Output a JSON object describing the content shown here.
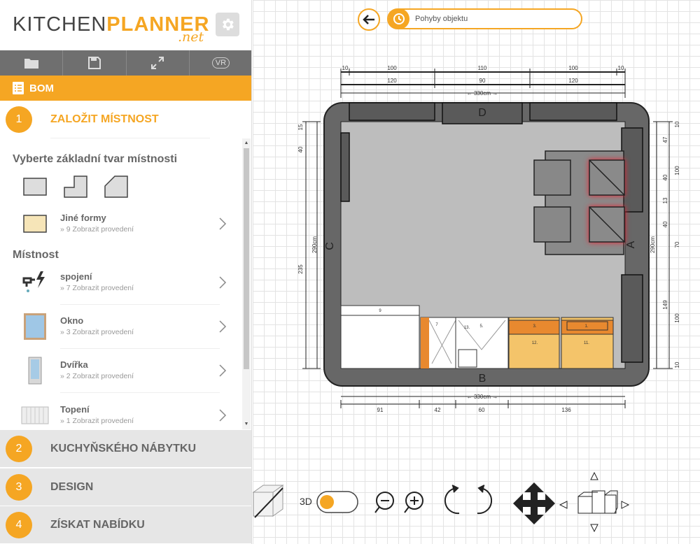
{
  "logo": {
    "part1": "KITCHEN",
    "part2": "PLANNER",
    "part3": ".net"
  },
  "toolbar": {
    "vr_label": "VR"
  },
  "bom": {
    "label": "BOM"
  },
  "steps": [
    {
      "num": "1",
      "label": "ZALOŽIT MÍSTNOST"
    },
    {
      "num": "2",
      "label": "KUCHYŇSKÉHO NÁBYTKU"
    },
    {
      "num": "3",
      "label": "DESIGN"
    },
    {
      "num": "4",
      "label": "ZÍSKAT NABÍDKU"
    }
  ],
  "panel": {
    "shape_title": "Vyberte základní tvar místnosti",
    "other_forms": {
      "name": "Jiné formy",
      "sub": "» 9 Zobrazit provedení"
    },
    "room_title": "Místnost",
    "items": [
      {
        "name": "spojení",
        "sub": "» 7 Zobrazit provedení"
      },
      {
        "name": "Okno",
        "sub": "» 3 Zobrazit provedení"
      },
      {
        "name": "Dvířka",
        "sub": "» 2 Zobrazit provedení"
      },
      {
        "name": "Topení",
        "sub": "» 1 Zobrazit provedení"
      }
    ]
  },
  "history": {
    "label": "Pohyby objektu"
  },
  "plan": {
    "walls": {
      "top": "D",
      "bottom": "B",
      "left": "C",
      "right": "A"
    },
    "dims_top_row1": [
      "10",
      "100",
      "110",
      "100",
      "10"
    ],
    "dims_top_row2": [
      "120",
      "90",
      "120"
    ],
    "total_width": "330cm",
    "dims_bottom": [
      "91",
      "42",
      "60",
      "136"
    ],
    "dims_left_outer": [
      "15",
      "40",
      "235"
    ],
    "total_height": "290cm",
    "dims_right_outer": [
      "10",
      "47",
      "100",
      "40",
      "13",
      "40",
      "70",
      "149",
      "100",
      "10"
    ],
    "cabinet_labels": [
      "9",
      "7",
      "13.",
      "5.",
      "3.",
      "1.",
      "12.",
      "11."
    ]
  },
  "controls": {
    "label_3d": "3D"
  },
  "colors": {
    "accent": "#f5a623",
    "sidebar_gray": "#6f6f6f",
    "wall": "#676767",
    "floor": "#bdbdbd"
  }
}
